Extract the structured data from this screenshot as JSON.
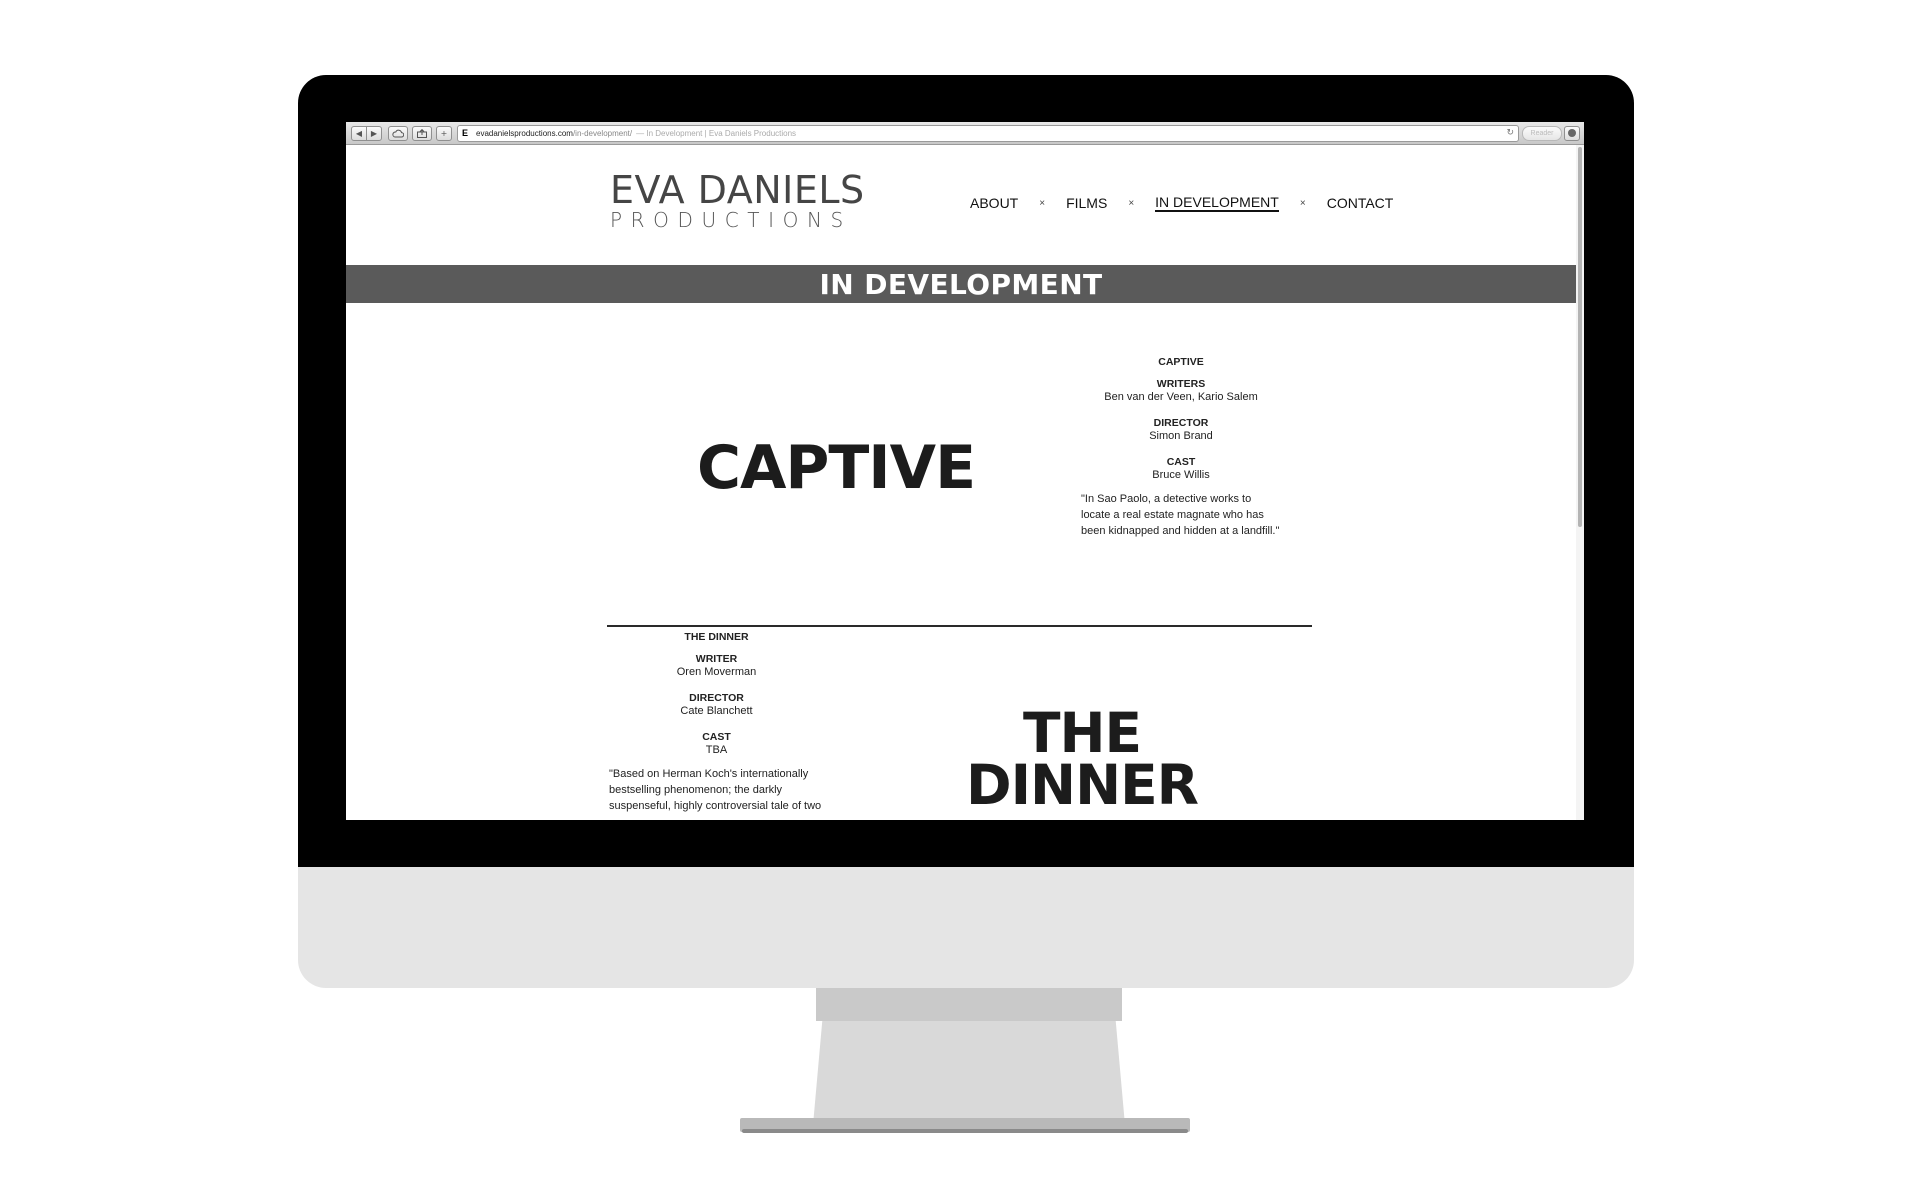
{
  "browser": {
    "url_domain": "evadanielsproductions.com",
    "url_path": "/in-development/",
    "url_separator": "—",
    "page_title": "In Development | Eva Daniels Productions",
    "favicon_letter": "E",
    "reader_label": "Reader",
    "back_icon": "◀",
    "forward_icon": "▶",
    "reload_icon": "↻",
    "add_icon": "+"
  },
  "site": {
    "logo_main": "EVA DANIELS",
    "logo_sub": "PRODUCTIONS",
    "nav": {
      "about": "ABOUT",
      "films": "FILMS",
      "in_development": "IN DEVELOPMENT",
      "contact": "CONTACT",
      "separator": "×"
    },
    "page_heading": "IN DEVELOPMENT"
  },
  "films": {
    "captive": {
      "big_title": "CAPTIVE",
      "title": "CAPTIVE",
      "writers_label": "WRITERS",
      "writers": "Ben van der Veen, Kario Salem",
      "director_label": "DIRECTOR",
      "director": "Simon Brand",
      "cast_label": "CAST",
      "cast": "Bruce Willis",
      "description": "\"In Sao Paolo, a detective works to locate a real estate magnate who has been kidnapped and hidden at a landfill.\""
    },
    "the_dinner": {
      "big_title_line1": "THE",
      "big_title_line2": "DINNER",
      "title": "THE DINNER",
      "writer_label": "WRITER",
      "writer": "Oren Moverman",
      "director_label": "DIRECTOR",
      "director": "Cate Blanchett",
      "cast_label": "CAST",
      "cast": "TBA",
      "description": "\"Based on Herman Koch's internationally bestselling phenomenon; the darkly suspenseful, highly controversial tale of two"
    }
  },
  "colors": {
    "band": "#5a5a5a",
    "bezel": "#000000",
    "chin": "#e5e5e5",
    "text": "#1c1c1c"
  }
}
